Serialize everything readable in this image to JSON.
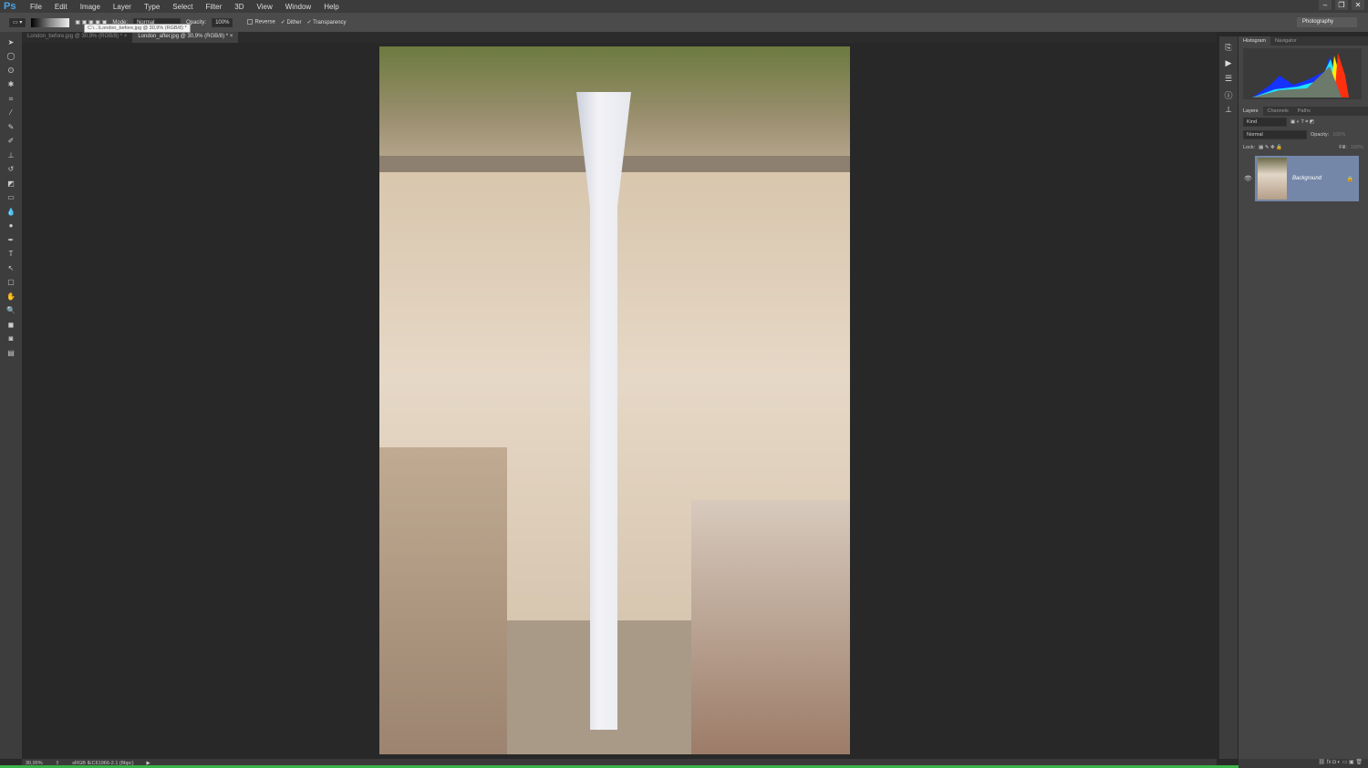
{
  "app": {
    "logo": "Ps",
    "menu": [
      "File",
      "Edit",
      "Image",
      "Layer",
      "Type",
      "Select",
      "Filter",
      "3D",
      "View",
      "Window",
      "Help"
    ],
    "window_controls": [
      "minimize",
      "restore",
      "close"
    ]
  },
  "options": {
    "mode_label": "Mode:",
    "mode_value": "Normal",
    "opacity_label": "Opacity:",
    "opacity_value": "100%",
    "reverse": "Reverse",
    "dither": "Dither",
    "transparency": "Transparency",
    "workspace": "Photography"
  },
  "tabs": [
    {
      "label": "London_before.jpg @ 30,9% (RGB/8) *",
      "active": false
    },
    {
      "label": "London_after.jpg @ 30,9% (RGB/8) *",
      "active": true
    }
  ],
  "tooltip": "C:\\...\\London_before.jpg @ 30,9% (RGB/8) *",
  "status": {
    "zoom": "30,95%",
    "profile": "sRGB IEC61966-2.1 (8bpc)"
  },
  "panels": {
    "top_tabs": [
      "Histogram",
      "Navigator"
    ],
    "layer_tabs": [
      "Layers",
      "Channels",
      "Paths"
    ],
    "kind": "Kind",
    "blend": "Normal",
    "opacity_label": "Opacity:",
    "opacity_value": "100%",
    "lock_label": "Lock:",
    "fill_label": "Fill:",
    "fill_value": "100%",
    "layer_name": "Background"
  }
}
